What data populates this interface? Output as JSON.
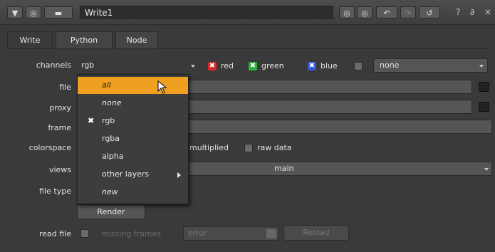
{
  "title_bar": {
    "node_name": "Write1",
    "help": "?",
    "float": "∂",
    "close": "×"
  },
  "tabs": [
    {
      "label": "Write"
    },
    {
      "label": "Python"
    },
    {
      "label": "Node"
    }
  ],
  "channels": {
    "label": "channels",
    "value": "rgb",
    "red": "red",
    "green": "green",
    "blue": "blue",
    "alpha_layer": "none"
  },
  "file": {
    "label": "file"
  },
  "proxy": {
    "label": "proxy"
  },
  "frame": {
    "label": "frame"
  },
  "colorspace": {
    "label": "colorspace",
    "premultiplied": "multiplied",
    "raw_data": "raw data"
  },
  "views": {
    "label": "views",
    "value": "main"
  },
  "file_type": {
    "label": "file type"
  },
  "render": {
    "label": "Render"
  },
  "read_file": {
    "label": "read file",
    "missing_frames": "missing frames",
    "missing_value": "error",
    "reload": "Reload"
  },
  "dropdown_menu": {
    "items": [
      {
        "label": "all"
      },
      {
        "label": "none"
      },
      {
        "label": "rgb"
      },
      {
        "label": "rgba"
      },
      {
        "label": "alpha"
      },
      {
        "label": "other layers"
      },
      {
        "label": "new"
      }
    ]
  },
  "colors": {
    "highlight": "#f0a020",
    "red_check": "#d42a2a",
    "green_check": "#2eae3a",
    "blue_check": "#3456d8"
  }
}
